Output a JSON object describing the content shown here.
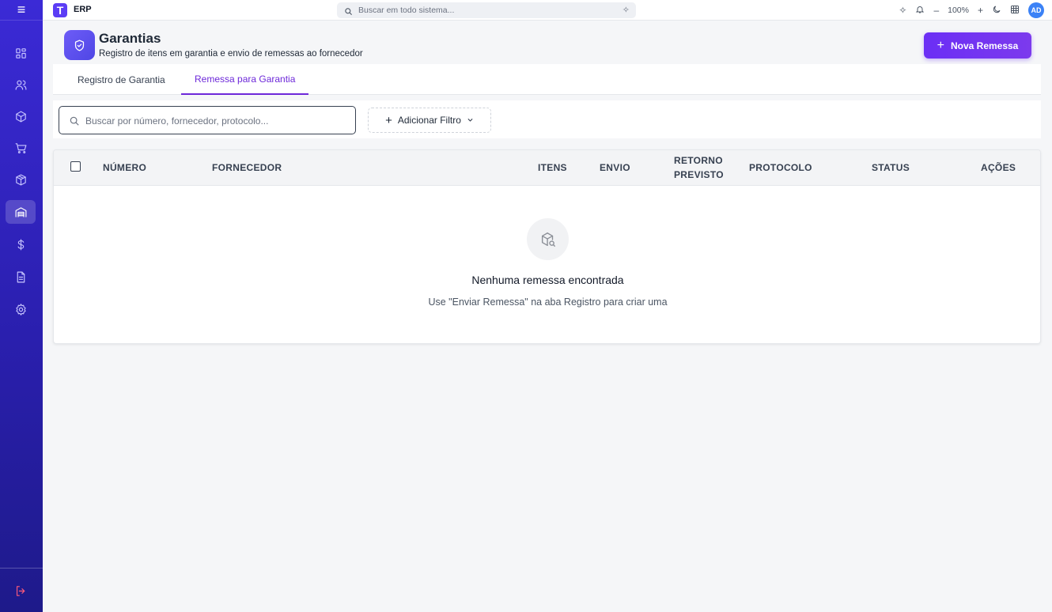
{
  "app": {
    "logo_letter": "T",
    "name": "ERP"
  },
  "topbar": {
    "search_placeholder": "Buscar em todo sistema...",
    "zoom": "100%",
    "user_initials": "AD"
  },
  "page": {
    "title": "Garantias",
    "subtitle": "Registro de itens em garantia e envio de remessas ao fornecedor",
    "primary_action": "Nova Remessa"
  },
  "tabs": [
    {
      "label": "Registro de Garantia",
      "active": false
    },
    {
      "label": "Remessa para Garantia",
      "active": true
    }
  ],
  "filters": {
    "search_placeholder": "Buscar por número, fornecedor, protocolo...",
    "add_filter_label": "Adicionar Filtro"
  },
  "table": {
    "columns": [
      "NÚMERO",
      "FORNECEDOR",
      "ITENS",
      "ENVIO",
      "RETORNO",
      "PREVISTO",
      "PROTOCOLO",
      "STATUS",
      "AÇÕES"
    ],
    "rows": []
  },
  "empty_state": {
    "title": "Nenhuma remessa encontrada",
    "message": "Use \"Enviar Remessa\" na aba Registro para criar uma"
  },
  "colors": {
    "accent": "#6d28d9",
    "sidebar": "#2a1fae",
    "primary_button": "#6b2ef5"
  }
}
